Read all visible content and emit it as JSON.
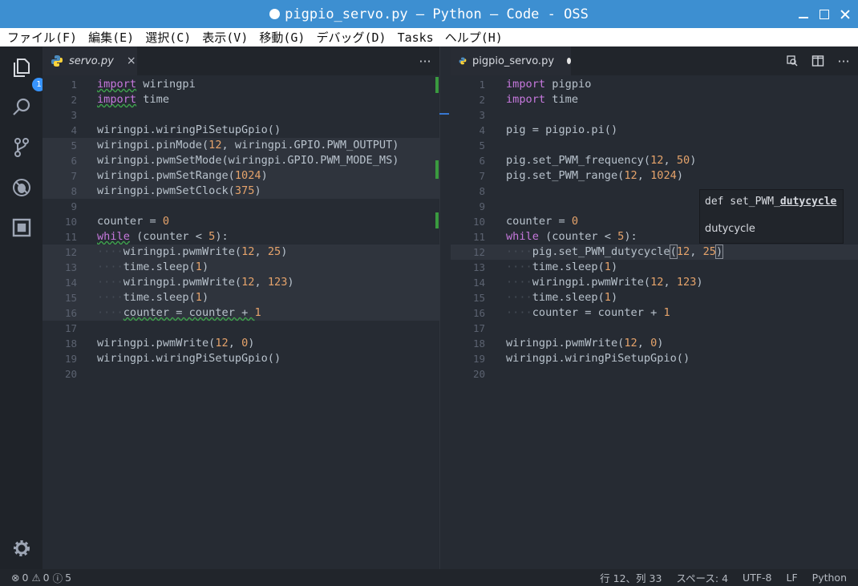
{
  "window": {
    "title": "pigpio_servo.py — Python — Code - OSS"
  },
  "menu": [
    "ファイル(F)",
    "編集(E)",
    "選択(C)",
    "表示(V)",
    "移動(G)",
    "デバッグ(D)",
    "Tasks",
    "ヘルプ(H)"
  ],
  "activity": {
    "icons": [
      "explorer-icon",
      "search-icon",
      "source-control-icon",
      "debug-icon",
      "extensions-icon",
      "gear-icon"
    ],
    "explorer_badge": "1"
  },
  "left_editor": {
    "tab_label": "servo.py",
    "tab_close": "×",
    "more": "···",
    "lines": [
      [
        [
          "k",
          "import"
        ],
        [
          "t",
          " wiringpi"
        ]
      ],
      [
        [
          "k",
          "import"
        ],
        [
          "t",
          " time"
        ]
      ],
      [],
      [
        [
          "t",
          "wiringpi.wiringPiSetupGpio()"
        ]
      ],
      [
        [
          "t",
          "wiringpi.pinMode("
        ],
        [
          "n",
          "12"
        ],
        [
          "t",
          ", wiringpi.GPIO.PWM_OUTPUT)"
        ]
      ],
      [
        [
          "t",
          "wiringpi.pwmSetMode(wiringpi.GPIO.PWM_MODE_MS)"
        ]
      ],
      [
        [
          "t",
          "wiringpi.pwmSetRange("
        ],
        [
          "n",
          "1024"
        ],
        [
          "t",
          ")"
        ]
      ],
      [
        [
          "t",
          "wiringpi.pwmSetClock("
        ],
        [
          "n",
          "375"
        ],
        [
          "t",
          ")"
        ]
      ],
      [],
      [
        [
          "t",
          "counter = "
        ],
        [
          "n",
          "0"
        ]
      ],
      [
        [
          "k",
          "while"
        ],
        [
          "t",
          " (counter < "
        ],
        [
          "n",
          "5"
        ],
        [
          "t",
          "):"
        ]
      ],
      [
        [
          "i",
          "····"
        ],
        [
          "t",
          "wiringpi.pwmWrite("
        ],
        [
          "n",
          "12"
        ],
        [
          "t",
          ", "
        ],
        [
          "n",
          "25"
        ],
        [
          "t",
          ")"
        ]
      ],
      [
        [
          "i",
          "····"
        ],
        [
          "t",
          "time.sleep("
        ],
        [
          "n",
          "1"
        ],
        [
          "t",
          ")"
        ]
      ],
      [
        [
          "i",
          "····"
        ],
        [
          "t",
          "wiringpi.pwmWrite("
        ],
        [
          "n",
          "12"
        ],
        [
          "t",
          ", "
        ],
        [
          "n",
          "123"
        ],
        [
          "t",
          ")"
        ]
      ],
      [
        [
          "i",
          "····"
        ],
        [
          "t",
          "time.sleep("
        ],
        [
          "n",
          "1"
        ],
        [
          "t",
          ")"
        ]
      ],
      [
        [
          "i",
          "····"
        ],
        [
          "t",
          "counter = counter + "
        ],
        [
          "n",
          "1"
        ]
      ],
      [],
      [
        [
          "t",
          "wiringpi.pwmWrite("
        ],
        [
          "n",
          "12"
        ],
        [
          "t",
          ", "
        ],
        [
          "n",
          "0"
        ],
        [
          "t",
          ")"
        ]
      ],
      [
        [
          "t",
          "wiringpi.wiringPiSetupGpio()"
        ]
      ],
      []
    ]
  },
  "right_editor": {
    "tab_label": "pigpio_servo.py",
    "lines": [
      [
        [
          "k",
          "import"
        ],
        [
          "t",
          " pigpio"
        ]
      ],
      [
        [
          "k",
          "import"
        ],
        [
          "t",
          " time"
        ]
      ],
      [],
      [
        [
          "t",
          "pig = pigpio.pi()"
        ]
      ],
      [],
      [
        [
          "t",
          "pig.set_PWM_frequency("
        ],
        [
          "n",
          "12"
        ],
        [
          "t",
          ", "
        ],
        [
          "n",
          "50"
        ],
        [
          "t",
          ")"
        ]
      ],
      [
        [
          "t",
          "pig.set_PWM_range("
        ],
        [
          "n",
          "12"
        ],
        [
          "t",
          ", "
        ],
        [
          "n",
          "1024"
        ],
        [
          "t",
          ")"
        ]
      ],
      [],
      [],
      [
        [
          "t",
          "counter = "
        ],
        [
          "n",
          "0"
        ]
      ],
      [
        [
          "k",
          "while"
        ],
        [
          "t",
          " (counter < "
        ],
        [
          "n",
          "5"
        ],
        [
          "t",
          "):"
        ]
      ],
      [
        [
          "i",
          "····"
        ],
        [
          "t",
          "pig.set_PWM_dutycycle"
        ],
        [
          "b",
          "("
        ],
        [
          "n",
          "12"
        ],
        [
          "t",
          ", "
        ],
        [
          "n",
          "25"
        ],
        [
          "b",
          ")"
        ]
      ],
      [
        [
          "i",
          "····"
        ],
        [
          "t",
          "time.sleep("
        ],
        [
          "n",
          "1"
        ],
        [
          "t",
          ")"
        ]
      ],
      [
        [
          "i",
          "····"
        ],
        [
          "t",
          "wiringpi.pwmWrite("
        ],
        [
          "n",
          "12"
        ],
        [
          "t",
          ", "
        ],
        [
          "n",
          "123"
        ],
        [
          "t",
          ")"
        ]
      ],
      [
        [
          "i",
          "····"
        ],
        [
          "t",
          "time.sleep("
        ],
        [
          "n",
          "1"
        ],
        [
          "t",
          ")"
        ]
      ],
      [
        [
          "i",
          "····"
        ],
        [
          "t",
          "counter = counter + "
        ],
        [
          "n",
          "1"
        ]
      ],
      [],
      [
        [
          "t",
          "wiringpi.pwmWrite("
        ],
        [
          "n",
          "12"
        ],
        [
          "t",
          ", "
        ],
        [
          "n",
          "0"
        ],
        [
          "t",
          ")"
        ]
      ],
      [
        [
          "t",
          "wiringpi.wiringPiSetupGpio()"
        ]
      ],
      []
    ]
  },
  "hover": {
    "signature_prefix": "def set_PWM_",
    "signature_param": "dutycycle",
    "doc": "dutycycle"
  },
  "status": {
    "errors": "0",
    "warnings": "0",
    "infos": "5",
    "position": "行 12、列 33",
    "indent": "スペース: 4",
    "encoding": "UTF-8",
    "eol": "LF",
    "language": "Python"
  },
  "colors": {
    "titlebar": "#3d8fd1",
    "keyword": "#c678dd",
    "number": "#e5a36b",
    "text": "#b8c2cc",
    "badge": "#3794ff",
    "git_added": "#3a9a3f"
  }
}
